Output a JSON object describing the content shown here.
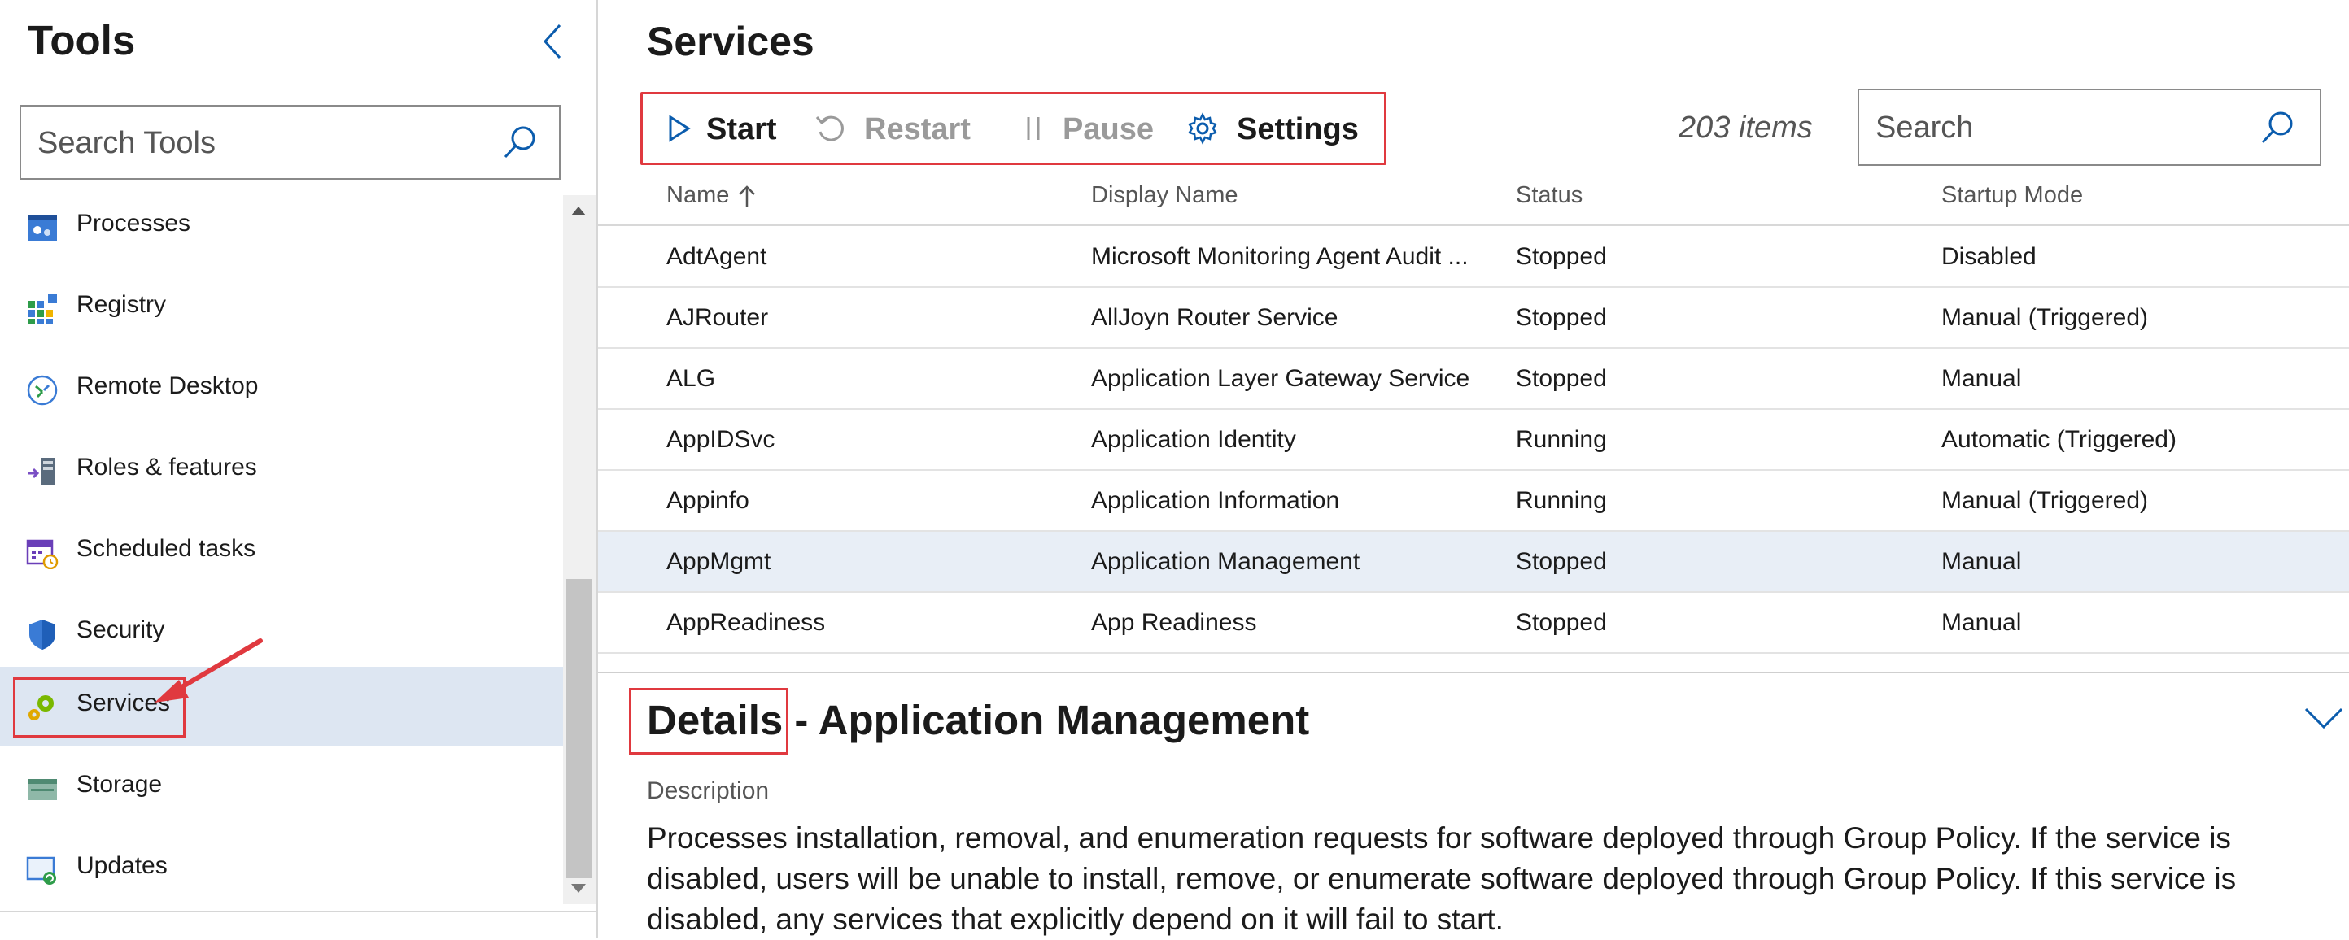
{
  "sidebar": {
    "title": "Tools",
    "search_placeholder": "Search Tools",
    "items": [
      {
        "label": "Processes",
        "icon": "processes-icon"
      },
      {
        "label": "Registry",
        "icon": "registry-icon"
      },
      {
        "label": "Remote Desktop",
        "icon": "remote-desktop-icon"
      },
      {
        "label": "Roles & features",
        "icon": "roles-features-icon"
      },
      {
        "label": "Scheduled tasks",
        "icon": "scheduled-tasks-icon"
      },
      {
        "label": "Security",
        "icon": "shield-icon"
      },
      {
        "label": "Services",
        "icon": "gears-icon",
        "selected": true
      },
      {
        "label": "Storage",
        "icon": "storage-icon"
      },
      {
        "label": "Updates",
        "icon": "updates-icon"
      }
    ]
  },
  "main": {
    "title": "Services",
    "toolbar": {
      "start": "Start",
      "restart": "Restart",
      "pause": "Pause",
      "settings": "Settings"
    },
    "item_count": "203 items",
    "search_placeholder": "Search",
    "columns": {
      "name": "Name",
      "display_name": "Display Name",
      "status": "Status",
      "startup_mode": "Startup Mode"
    },
    "rows": [
      {
        "name": "AdtAgent",
        "display_name": "Microsoft Monitoring Agent Audit ...",
        "status": "Stopped",
        "startup_mode": "Disabled"
      },
      {
        "name": "AJRouter",
        "display_name": "AllJoyn Router Service",
        "status": "Stopped",
        "startup_mode": "Manual (Triggered)"
      },
      {
        "name": "ALG",
        "display_name": "Application Layer Gateway Service",
        "status": "Stopped",
        "startup_mode": "Manual"
      },
      {
        "name": "AppIDSvc",
        "display_name": "Application Identity",
        "status": "Running",
        "startup_mode": "Automatic (Triggered)"
      },
      {
        "name": "Appinfo",
        "display_name": "Application Information",
        "status": "Running",
        "startup_mode": "Manual (Triggered)"
      },
      {
        "name": "AppMgmt",
        "display_name": "Application Management",
        "status": "Stopped",
        "startup_mode": "Manual",
        "selected": true
      },
      {
        "name": "AppReadiness",
        "display_name": "App Readiness",
        "status": "Stopped",
        "startup_mode": "Manual"
      }
    ],
    "details": {
      "title": "Details - Application Management",
      "description_label": "Description",
      "description": "Processes installation, removal, and enumeration requests for software deployed through Group Policy. If the service is disabled, users will be unable to install, remove, or enumerate software deployed through Group Policy. If this service is disabled, any services that explicitly depend on it will fail to start."
    }
  },
  "colors": {
    "accent": "#0b5cad",
    "highlight_box": "#e0393f",
    "selected_row": "#e8eef6",
    "selected_nav": "#dde6f2"
  }
}
